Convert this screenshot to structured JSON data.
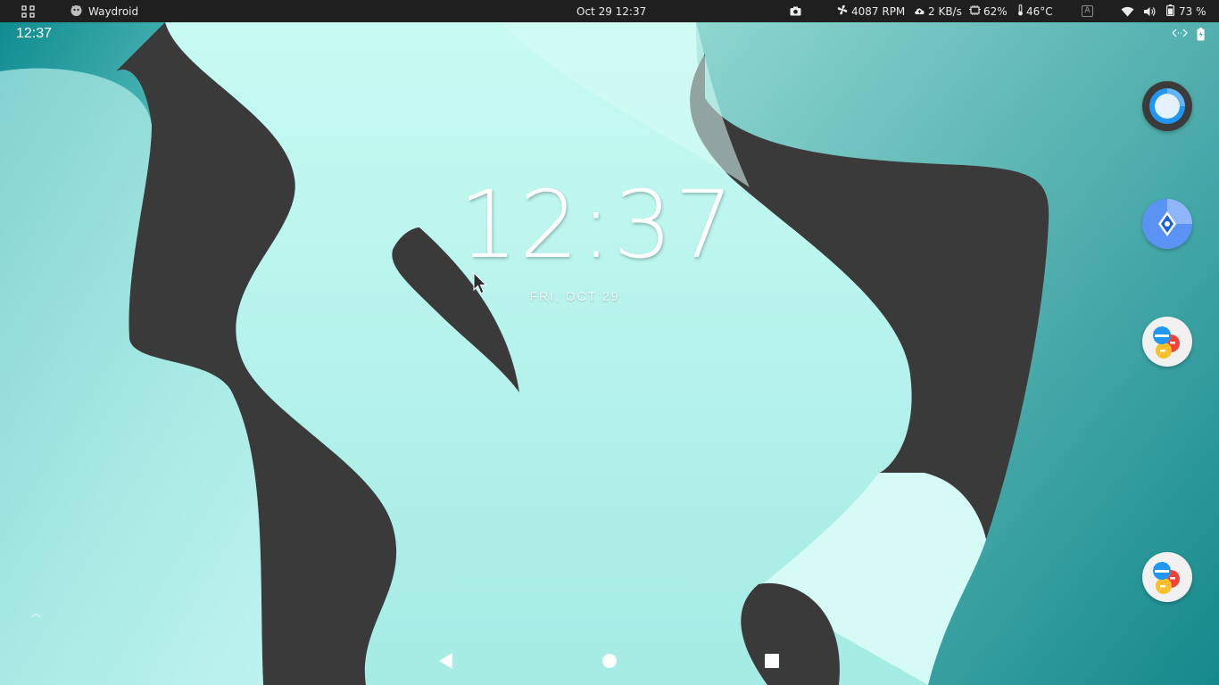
{
  "topbar": {
    "app_name": "Waydroid",
    "clock": "Oct 29  12:37",
    "fan_rpm": "4087 RPM",
    "network_speed": "2 KB/s",
    "cpu_usage": "62%",
    "temperature": "46°C",
    "keyboard_layout": "A",
    "battery": "73 %"
  },
  "android": {
    "status_time": "12:37",
    "lock_time": "12:37",
    "lock_date": "FRI, OCT 29"
  },
  "icons": {
    "apps_grid": "apps-grid-icon",
    "camera": "camera-icon",
    "fan": "fan-icon",
    "cloud": "cloud-upload-icon",
    "cpu": "cpu-icon",
    "thermometer": "thermometer-icon",
    "wifi": "wifi-icon",
    "volume": "volume-icon",
    "battery": "battery-icon"
  },
  "colors": {
    "topbar_bg": "#1f1f1f",
    "wallpaper_light": "#bff8f1",
    "wallpaper_dark": "#3a3a3a",
    "wallpaper_teal": "#2a9a9c"
  }
}
